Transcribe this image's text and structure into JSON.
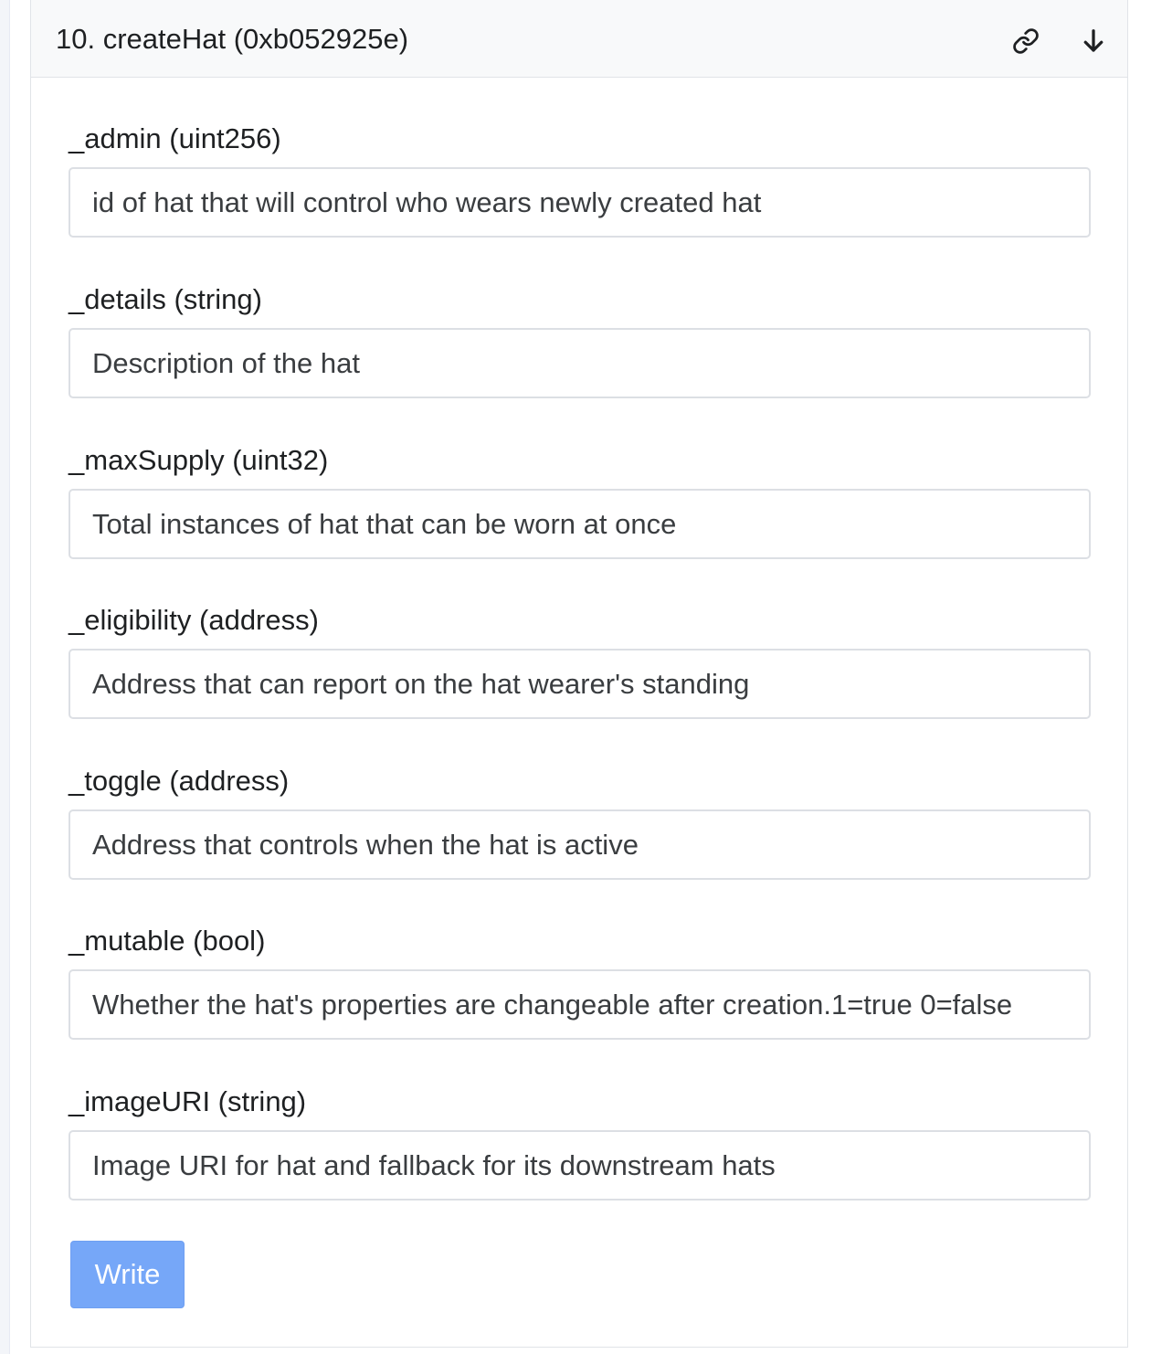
{
  "function_card": {
    "title": "10. createHat (0xb052925e)",
    "icons": {
      "link": "link-icon",
      "expand": "arrow-down-icon"
    }
  },
  "fields": [
    {
      "label": "_admin (uint256)",
      "placeholder": "id of hat that will control who wears newly created hat",
      "value": ""
    },
    {
      "label": "_details (string)",
      "placeholder": "Description of the hat",
      "value": ""
    },
    {
      "label": "_maxSupply (uint32)",
      "placeholder": "Total instances of hat that can be worn at once",
      "value": ""
    },
    {
      "label": "_eligibility (address)",
      "placeholder": "Address that can report on the hat wearer's standing",
      "value": ""
    },
    {
      "label": "_toggle (address)",
      "placeholder": "Address that controls when the hat is active",
      "value": ""
    },
    {
      "label": "_mutable (bool)",
      "placeholder": "Whether the hat's properties are changeable after creation.1=true 0=false",
      "value": ""
    },
    {
      "label": "_imageURI (string)",
      "placeholder": "Image URI for hat and fallback for its downstream hats",
      "value": ""
    }
  ],
  "write_button": {
    "label": "Write"
  },
  "colors": {
    "header_bg": "#f8f9fa",
    "button_bg": "#76a7f8",
    "border": "#dcdfe4"
  }
}
